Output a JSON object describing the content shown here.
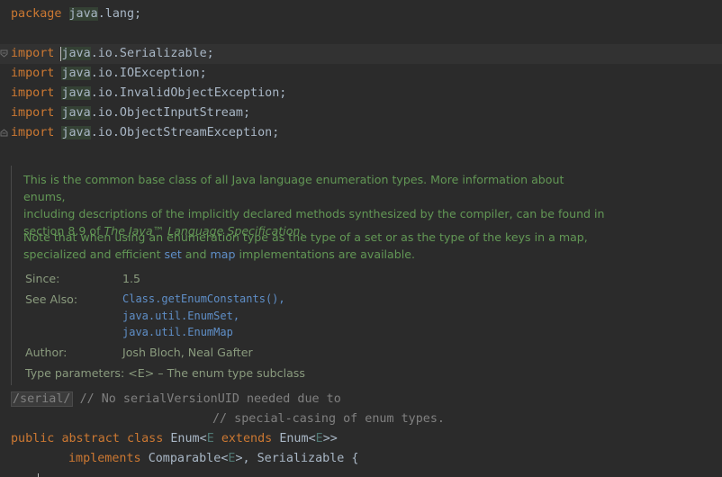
{
  "code": {
    "package_kw": "package",
    "package_name_hl": "java",
    "package_rest": ".lang;",
    "import_kw": "import",
    "imports": [
      {
        "hl": "java",
        "rest": ".io.Serializable;"
      },
      {
        "hl": "java",
        "rest": ".io.IOException;"
      },
      {
        "hl": "java",
        "rest": ".io.InvalidObjectException;"
      },
      {
        "hl": "java",
        "rest": ".io.ObjectInputStream;"
      },
      {
        "hl": "java",
        "rest": ".io.ObjectStreamException;"
      }
    ],
    "serial_tag": "/serial/",
    "comment1": "// No serialVersionUID needed due to",
    "comment2": "// special-casing of enum types.",
    "decl": {
      "public": "public",
      "abstract": "abstract",
      "class": "class",
      "name": "Enum",
      "lt1": "<",
      "tp1": "E",
      "extends": "extends",
      "super": "Enum",
      "lt2": "<",
      "tp2": "E",
      "gt2": ">>",
      "implements": "implements",
      "iface1": "Comparable",
      "lt3": "<",
      "tp3": "E",
      "gt3": ">",
      "rest": ", Serializable {"
    }
  },
  "doc": {
    "p1_a": "This is the common base class of all Java language enumeration types. More information about enums,",
    "p1_b": "including descriptions of the implicitly declared methods synthesized by the compiler, can be found in",
    "p1_c_pre": "section 8.9 of ",
    "p1_c_em": "The Java™ Language Specification",
    "p1_c_post": ".",
    "p2_a": "Note that when using an enumeration type as the type of a set or as the type of the keys in a map,",
    "p2_b_pre": "specialized and efficient ",
    "p2_b_set": "set",
    "p2_b_mid": " and ",
    "p2_b_map": "map",
    "p2_b_post": " implementations are available.",
    "since_label": "Since:",
    "since_value": "1.5",
    "see_label": "See Also:",
    "see_links": [
      "Class.getEnumConstants(),",
      "java.util.EnumSet,",
      "java.util.EnumMap"
    ],
    "author_label": "Author:",
    "author_value": "Josh Bloch, Neal Gafter",
    "type_params": "Type parameters: <E> – The enum type subclass"
  },
  "colors": {
    "background": "#2b2b2b",
    "keyword": "#cc7832",
    "doc_text": "#629755",
    "link": "#5f8fc8",
    "comment": "#808080"
  }
}
